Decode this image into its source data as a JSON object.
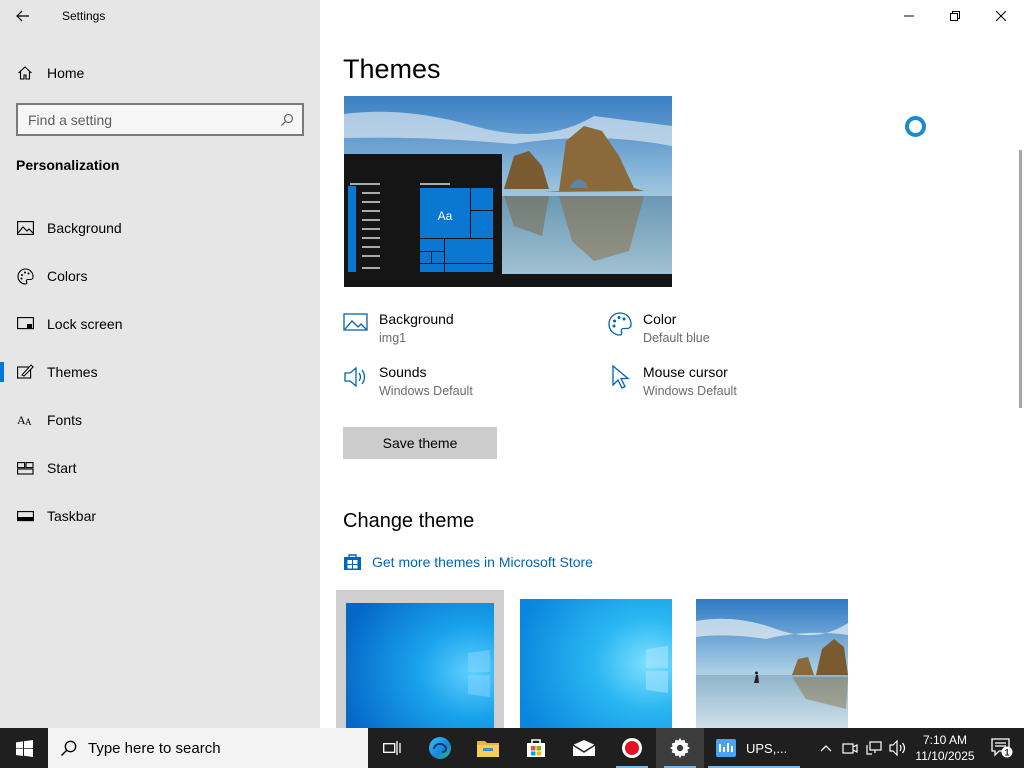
{
  "app": {
    "title": "Settings"
  },
  "sidebar": {
    "home_label": "Home",
    "search_placeholder": "Find a setting",
    "section_title": "Personalization",
    "items": [
      {
        "label": "Background",
        "icon": "picture-icon"
      },
      {
        "label": "Colors",
        "icon": "palette-icon"
      },
      {
        "label": "Lock screen",
        "icon": "lock-screen-icon"
      },
      {
        "label": "Themes",
        "icon": "brush-icon",
        "active": true
      },
      {
        "label": "Fonts",
        "icon": "font-icon"
      },
      {
        "label": "Start",
        "icon": "start-icon"
      },
      {
        "label": "Taskbar",
        "icon": "taskbar-icon"
      }
    ]
  },
  "main": {
    "title": "Themes",
    "props": {
      "background": {
        "label": "Background",
        "value": "img1"
      },
      "color": {
        "label": "Color",
        "value": "Default blue"
      },
      "sounds": {
        "label": "Sounds",
        "value": "Windows Default"
      },
      "cursor": {
        "label": "Mouse cursor",
        "value": "Windows Default"
      }
    },
    "save_label": "Save theme",
    "change_title": "Change theme",
    "store_link": "Get more themes in Microsoft Store",
    "preview_tile_text": "Aa"
  },
  "taskbar": {
    "search_placeholder": "Type here to search",
    "ups_label": "UPS,...",
    "time": "7:10 AM",
    "date": "11/10/2025",
    "notif_count": "1"
  },
  "colors": {
    "accent": "#0078d7",
    "link": "#0066b4",
    "taskbar": "#1f1f1f",
    "sidebar": "#e6e6e6"
  }
}
